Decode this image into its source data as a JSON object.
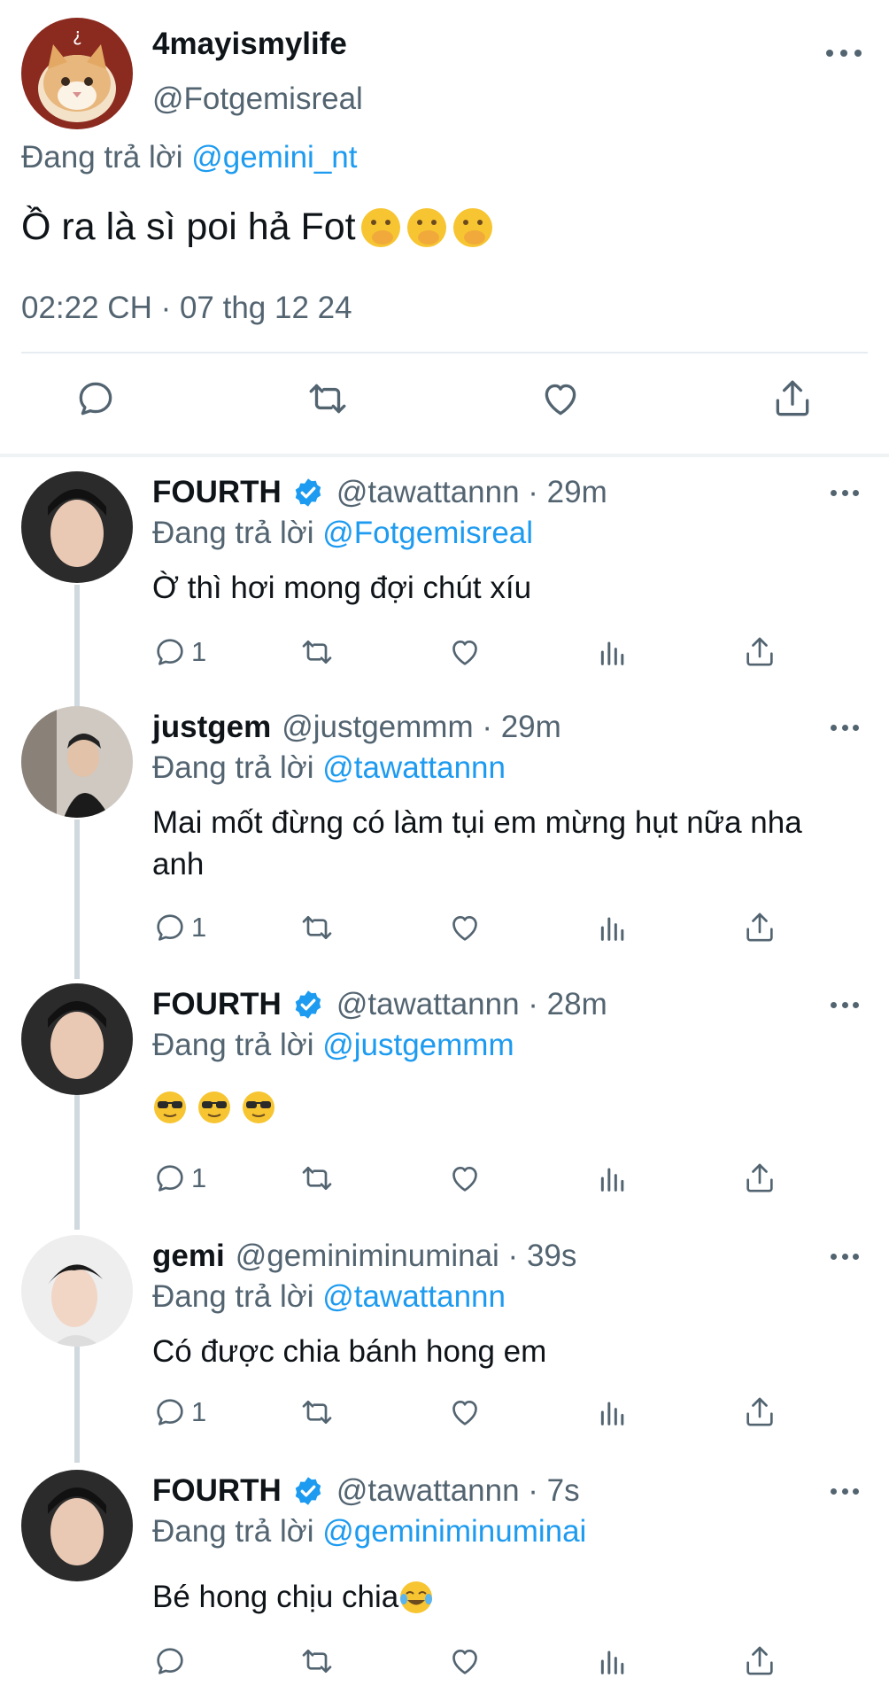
{
  "main_tweet": {
    "display_name": "4mayismylife",
    "handle": "@Fotgemisreal",
    "replying_prefix": "Đang trả lời",
    "replying_to": "@gemini_nt",
    "text": "Ồ ra là sì poi hả Fot",
    "emojis": [
      "hand-over-mouth-emoji",
      "hand-over-mouth-emoji",
      "hand-over-mouth-emoji"
    ],
    "timestamp": "02:22 CH · 07 thg 12 24"
  },
  "replies": [
    {
      "display_name": "FOURTH",
      "verified": true,
      "handle_time": "@tawattannn · 29m",
      "replying_prefix": "Đang trả lời",
      "replying_to": "@Fotgemisreal",
      "text": "Ờ thì hơi mong đợi chút xíu",
      "reply_count": "1"
    },
    {
      "display_name": "justgem",
      "verified": false,
      "handle_time": "@justgemmm · 29m",
      "replying_prefix": "Đang trả lời",
      "replying_to": "@tawattannn",
      "text": "Mai mốt đừng có làm tụi em mừng hụt nữa nha anh",
      "reply_count": "1"
    },
    {
      "display_name": "FOURTH",
      "verified": true,
      "handle_time": "@tawattannn · 28m",
      "replying_prefix": "Đang trả lời",
      "replying_to": "@justgemmm",
      "text": "",
      "emojis": [
        "sunglasses-emoji",
        "sunglasses-emoji",
        "sunglasses-emoji"
      ],
      "reply_count": "1"
    },
    {
      "display_name": "gemi",
      "verified": false,
      "handle_time": "@geminiminuminai · 39s",
      "replying_prefix": "Đang trả lời",
      "replying_to": "@tawattannn",
      "text": "Có được chia bánh hong em",
      "reply_count": "1"
    },
    {
      "display_name": "FOURTH",
      "verified": true,
      "handle_time": "@tawattannn · 7s",
      "replying_prefix": "Đang trả lời",
      "replying_to": "@geminiminuminai",
      "text": "Bé hong chịu chia",
      "emojis": [
        "tears-of-joy-emoji"
      ],
      "reply_count": ""
    }
  ],
  "colors": {
    "link": "#1d9bf0",
    "secondary_text": "#536471",
    "verified": "#1d9bf0",
    "thread_line": "#cfd9de"
  }
}
